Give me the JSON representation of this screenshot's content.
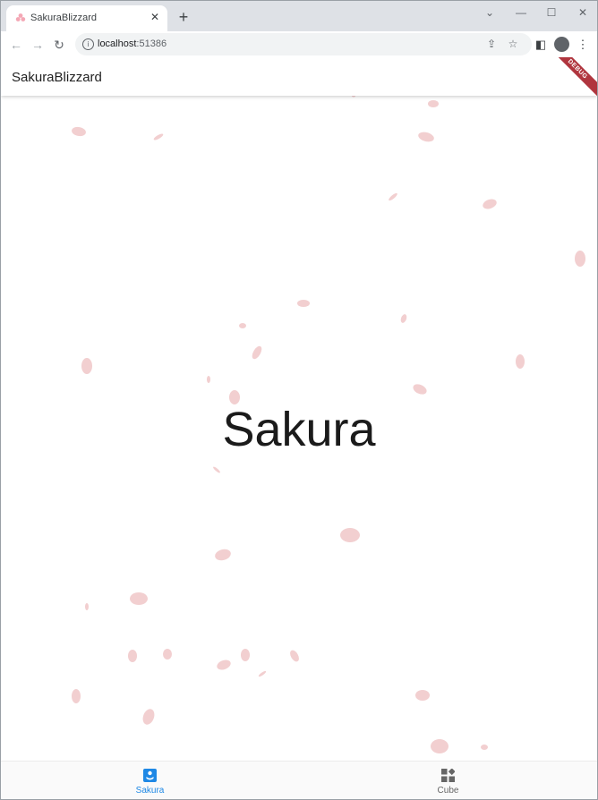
{
  "browser": {
    "tab_title": "SakuraBlizzard",
    "tab_close": "✕",
    "new_tab": "+",
    "controls": {
      "chevron": "⌄",
      "minimize": "—",
      "maximize": "☐",
      "close": "✕"
    },
    "nav": {
      "back": "←",
      "forward": "→",
      "reload": "↻"
    },
    "url_host": "localhost",
    "url_port": ":51386",
    "info_glyph": "i",
    "toolbar_icons": {
      "share": "⇪",
      "bookmark": "☆",
      "side_panel": "◧",
      "menu": "⋮"
    }
  },
  "app": {
    "title": "SakuraBlizzard",
    "debug_banner": "DEBUG",
    "center_text": "Sakura",
    "bottom_nav": [
      {
        "label": "Sakura",
        "icon": "sakura-icon",
        "selected": true
      },
      {
        "label": "Cube",
        "icon": "cube-icon",
        "selected": false
      }
    ]
  },
  "colors": {
    "accent": "#1e88e5",
    "inactive_nav": "#666666",
    "petal": "#f2cfd0",
    "debug": "#b0353e"
  }
}
